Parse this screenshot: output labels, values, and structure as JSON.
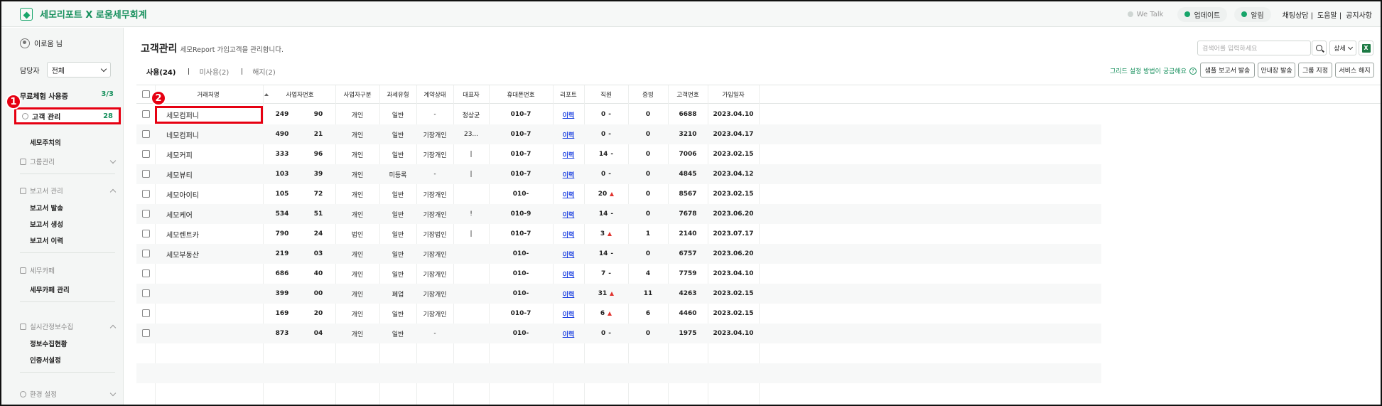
{
  "app": {
    "title": "세모리포트 X 로움세무회계"
  },
  "top": {
    "wetalk": "We Talk",
    "update": "업데이트",
    "alarm": "알림",
    "links": [
      "채팅상담 |",
      "도움말 |",
      "공지사항"
    ]
  },
  "sidebar": {
    "user": "이로움 님",
    "manager_label": "담당자",
    "manager_value": "전체",
    "trial_label": "무료체험 사용중",
    "trial_count": "3/3",
    "customer_mgmt": "고객 관리",
    "customer_count": "28",
    "semo_aux": "세모주치의",
    "group_mgmt": "그룹관리",
    "report_mgmt": "보고서 관리",
    "report_items": [
      "보고서 발송",
      "보고서 생성",
      "보고서 이력"
    ],
    "tax_cafe": "세무카페",
    "tax_cafe_mgmt": "세무카페 관리",
    "realtime": "실시간정보수집",
    "realtime_items": [
      "정보수집현황",
      "인증서설정"
    ],
    "env": "환경 설정"
  },
  "badges": {
    "one": "1",
    "two": "2"
  },
  "main": {
    "title": "고객관리",
    "subtitle": "세모Report 가입고객을 관리합니다.",
    "search_placeholder": "검색어를 입력하세요",
    "detail": "상세",
    "excel": "X",
    "tabs": [
      "사용(24)",
      "미사용(2)",
      "해지(2)"
    ],
    "help": "그리드 설정 방법이 궁금해요",
    "help_q": "?",
    "buttons": [
      "샘플 보고서 발송",
      "안내장 발송",
      "그룹 지정",
      "서비스 해지"
    ]
  },
  "table": {
    "columns": [
      "거래처명",
      "사업자번호",
      "사업자구분",
      "과세유형",
      "계약상태",
      "대표자",
      "휴대폰번호",
      "리포트",
      "직원",
      "증빙",
      "고객번호",
      "가입일자"
    ],
    "rows": [
      {
        "name": "세모컴퍼니",
        "biz1": "249",
        "biz2": "90",
        "type": "개인",
        "tax": "일반",
        "contract": "-",
        "rep": "정상균",
        "phone": "010-7",
        "report": "이력",
        "staff": "0",
        "trend": "-",
        "proof": "0",
        "no": "6688",
        "date": "2023.04.10"
      },
      {
        "name": "네모컴퍼니",
        "biz1": "490",
        "biz2": "21",
        "type": "개인",
        "tax": "일반",
        "contract": "기장개인",
        "rep": "23...",
        "phone": "010-7",
        "report": "이력",
        "staff": "0",
        "trend": "-",
        "proof": "0",
        "no": "3210",
        "date": "2023.04.17"
      },
      {
        "name": "세모커피",
        "biz1": "333",
        "biz2": "96",
        "type": "개인",
        "tax": "일반",
        "contract": "기장개인",
        "rep": "|",
        "phone": "010-7",
        "report": "이력",
        "staff": "14",
        "trend": "-",
        "proof": "0",
        "no": "7006",
        "date": "2023.02.15"
      },
      {
        "name": "세모뷰티",
        "biz1": "103",
        "biz2": "39",
        "type": "개인",
        "tax": "미등록",
        "contract": "-",
        "rep": "|",
        "phone": "010-7",
        "report": "이력",
        "staff": "0",
        "trend": "-",
        "proof": "0",
        "no": "4845",
        "date": "2023.04.12"
      },
      {
        "name": "세모아이티",
        "biz1": "105",
        "biz2": "72",
        "type": "개인",
        "tax": "일반",
        "contract": "기장개인",
        "rep": "",
        "phone": "010-",
        "report": "이력",
        "staff": "20",
        "trend": "up",
        "proof": "0",
        "no": "8567",
        "date": "2023.02.15"
      },
      {
        "name": "세모케어",
        "biz1": "534",
        "biz2": "51",
        "type": "개인",
        "tax": "일반",
        "contract": "기장개인",
        "rep": "!",
        "phone": "010-9",
        "report": "이력",
        "staff": "14",
        "trend": "-",
        "proof": "0",
        "no": "7678",
        "date": "2023.06.20"
      },
      {
        "name": "세모렌트카",
        "biz1": "790",
        "biz2": "24",
        "type": "법인",
        "tax": "일반",
        "contract": "기장법인",
        "rep": "|",
        "phone": "010-7",
        "report": "이력",
        "staff": "3",
        "trend": "up",
        "proof": "1",
        "no": "2140",
        "date": "2023.07.17"
      },
      {
        "name": "세모부동산",
        "biz1": "219",
        "biz2": "03",
        "type": "개인",
        "tax": "일반",
        "contract": "기장개인",
        "rep": "",
        "phone": "010-",
        "report": "이력",
        "staff": "14",
        "trend": "-",
        "proof": "0",
        "no": "6757",
        "date": "2023.06.20"
      },
      {
        "name": "",
        "biz1": "686",
        "biz2": "40",
        "type": "개인",
        "tax": "일반",
        "contract": "기장개인",
        "rep": "",
        "phone": "010-",
        "report": "이력",
        "staff": "7",
        "trend": "-",
        "proof": "4",
        "no": "7759",
        "date": "2023.04.10"
      },
      {
        "name": "",
        "biz1": "399",
        "biz2": "00",
        "type": "개인",
        "tax": "폐업",
        "contract": "기장개인",
        "rep": "",
        "phone": "010-",
        "report": "이력",
        "staff": "31",
        "trend": "up",
        "proof": "11",
        "no": "4263",
        "date": "2023.02.15"
      },
      {
        "name": "",
        "biz1": "169",
        "biz2": "20",
        "type": "개인",
        "tax": "일반",
        "contract": "기장개인",
        "rep": "",
        "phone": "010-7",
        "report": "이력",
        "staff": "6",
        "trend": "up",
        "proof": "6",
        "no": "4460",
        "date": "2023.02.15"
      },
      {
        "name": "",
        "biz1": "873",
        "biz2": "04",
        "type": "개인",
        "tax": "일반",
        "contract": "-",
        "rep": "",
        "phone": "010-",
        "report": "이력",
        "staff": "0",
        "trend": "-",
        "proof": "0",
        "no": "1975",
        "date": "2023.04.10"
      }
    ]
  },
  "colors": {
    "brand": "#17a56a",
    "highlight": "#e60012",
    "link": "#1a3fe0",
    "up": "#e0342f"
  }
}
